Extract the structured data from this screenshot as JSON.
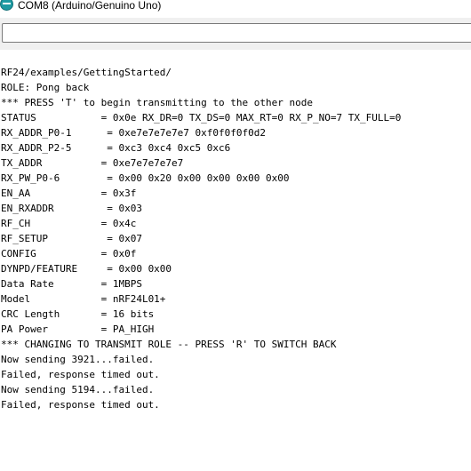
{
  "window": {
    "title": "COM8 (Arduino/Genuino Uno)"
  },
  "input": {
    "value": ""
  },
  "serial_lines": [
    "RF24/examples/GettingStarted/",
    "ROLE: Pong back",
    "*** PRESS 'T' to begin transmitting to the other node",
    "STATUS           = 0x0e RX_DR=0 TX_DS=0 MAX_RT=0 RX_P_NO=7 TX_FULL=0",
    "RX_ADDR_P0-1      = 0xe7e7e7e7e7 0xf0f0f0f0d2",
    "RX_ADDR_P2-5      = 0xc3 0xc4 0xc5 0xc6",
    "TX_ADDR          = 0xe7e7e7e7e7",
    "RX_PW_P0-6        = 0x00 0x20 0x00 0x00 0x00 0x00",
    "EN_AA            = 0x3f",
    "EN_RXADDR         = 0x03",
    "RF_CH            = 0x4c",
    "RF_SETUP          = 0x07",
    "CONFIG           = 0x0f",
    "DYNPD/FEATURE     = 0x00 0x00",
    "Data Rate        = 1MBPS",
    "Model            = nRF24L01+",
    "CRC Length       = 16 bits",
    "PA Power         = PA_HIGH",
    "*** CHANGING TO TRANSMIT ROLE -- PRESS 'R' TO SWITCH BACK",
    "Now sending 3921...failed.",
    "Failed, response timed out.",
    "Now sending 5194...failed.",
    "Failed, response timed out."
  ]
}
